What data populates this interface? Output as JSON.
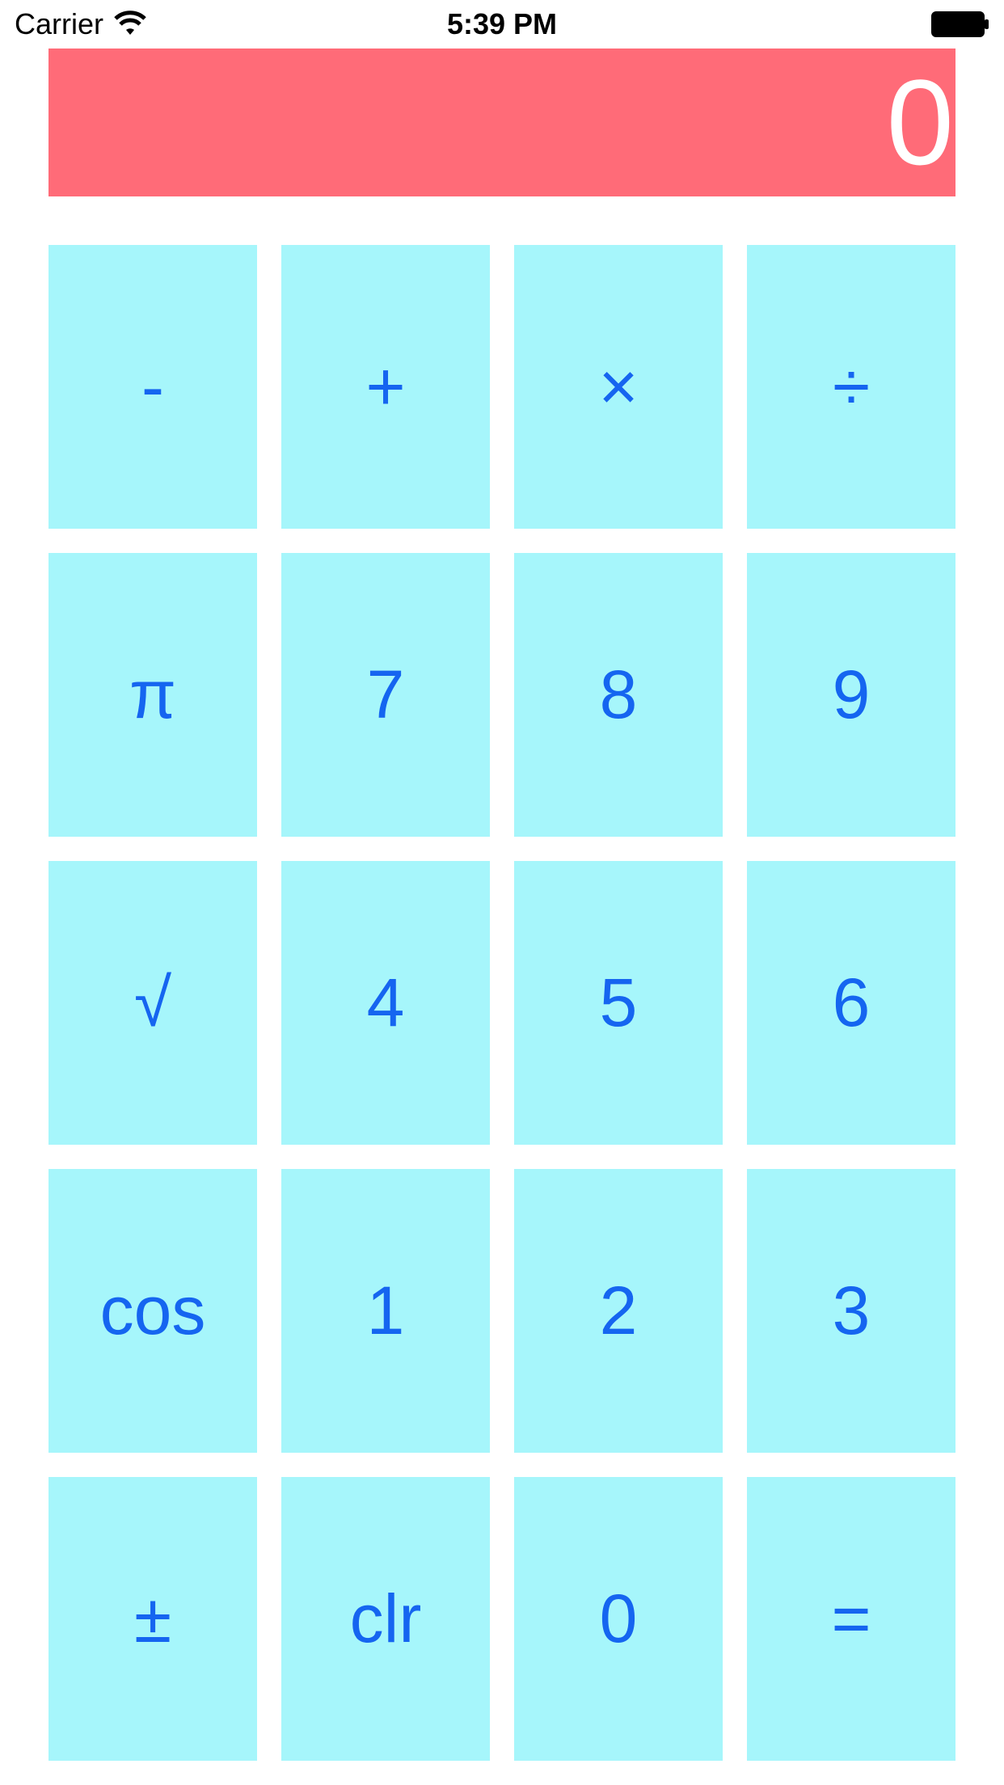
{
  "status_bar": {
    "carrier": "Carrier",
    "time": "5:39 PM",
    "icons": [
      "wifi-icon",
      "battery-icon"
    ]
  },
  "display": {
    "value": "0",
    "background_color": "#ff6b78",
    "text_color": "#ffffff"
  },
  "keypad": {
    "key_background_color": "#a6f6fb",
    "key_text_color": "#1565f0",
    "rows": [
      [
        "-",
        "+",
        "×",
        "÷"
      ],
      [
        "π",
        "7",
        "8",
        "9"
      ],
      [
        "√",
        "4",
        "5",
        "6"
      ],
      [
        "cos",
        "1",
        "2",
        "3"
      ],
      [
        "±",
        "clr",
        "0",
        "="
      ]
    ]
  }
}
